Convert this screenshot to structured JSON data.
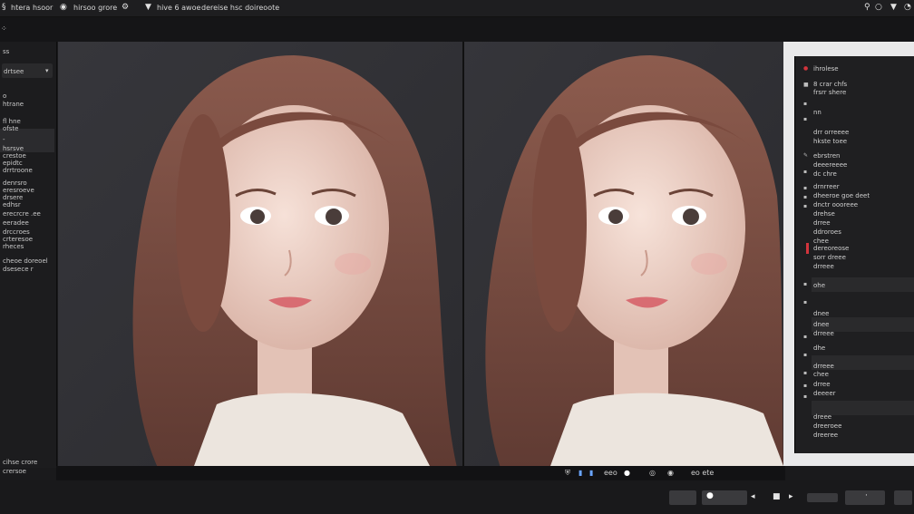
{
  "menubar": {
    "items": [
      "htera",
      "hsoor",
      "hirsoo grore",
      "hive 6 awoe",
      "dereise hsc doireoote"
    ]
  },
  "left_panel": {
    "items": [
      "ss",
      "drtsee",
      "o",
      "htrane",
      "fl hne",
      "ofste",
      "-",
      "hsrsve",
      "crestoe",
      "epidtc",
      "drrtroone",
      "denrsro",
      "eresroeve",
      "drsere",
      "edhsr",
      "erecrcre .ee",
      "eeradee",
      "drccroes",
      "crteresoe",
      "rheces",
      "cheoe doreoel",
      "dsesece r"
    ],
    "footer": [
      "cihse crore",
      "crersoe"
    ]
  },
  "right_panel": {
    "header": "ihrolese",
    "items": [
      "8 crar chfs",
      "frsrr shere",
      "nn",
      "drr orreeee",
      "hkste toee",
      "ebrstren",
      "deeereeee",
      "dc chre",
      "drnrreer",
      "dheeroe goe deet",
      "dnctr oooreee",
      "drehse",
      "drree",
      "ddroroes",
      "chee",
      "dereoreose",
      "sorr dreee",
      "drreee",
      "ohe",
      "dnee",
      "dnee",
      "drreee",
      "dhe",
      "drreee",
      "chee",
      "drree",
      "deeeer",
      "dreee",
      "dreeroee",
      "dreeree"
    ]
  },
  "status": {
    "zoom_text": "eeo",
    "label": "eo ete"
  },
  "colors": {
    "accent_blue": "#6aa5ff",
    "marker_red": "#d3343c",
    "hair": "#7a4a3e",
    "skin": "#f1d4c9"
  },
  "icons": [
    "apple-icon",
    "gear-icon",
    "shield-icon",
    "pin-icon",
    "dropdown-icon",
    "circle-icon"
  ]
}
